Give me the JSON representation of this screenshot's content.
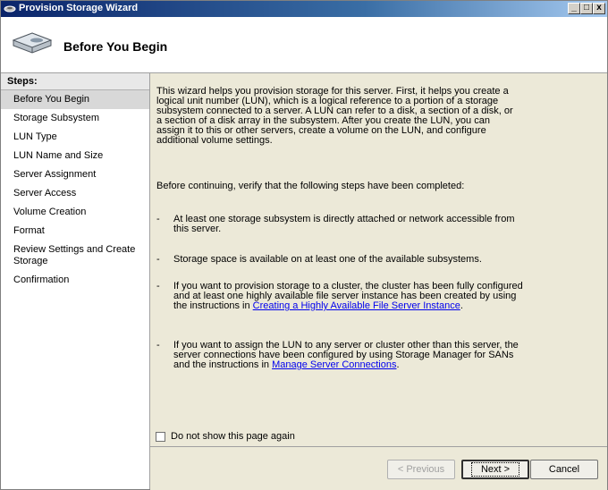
{
  "window": {
    "title": "Provision Storage Wizard"
  },
  "titlebar_buttons": {
    "minimize": "_",
    "maximize": "□",
    "close": "x"
  },
  "header": {
    "title": "Before You Begin"
  },
  "steps": {
    "label": "Steps:",
    "items": [
      {
        "line1": "Before You Begin",
        "line2": ""
      },
      {
        "line1": "Storage Subsystem",
        "line2": ""
      },
      {
        "line1": "LUN Type",
        "line2": ""
      },
      {
        "line1": "LUN Name and Size",
        "line2": ""
      },
      {
        "line1": "Server Assignment",
        "line2": ""
      },
      {
        "line1": "Server Access",
        "line2": ""
      },
      {
        "line1": "Volume Creation",
        "line2": ""
      },
      {
        "line1": "Format",
        "line2": ""
      },
      {
        "line1": "Review Settings and Create",
        "line2": "Storage"
      },
      {
        "line1": "Confirmation",
        "line2": ""
      }
    ]
  },
  "content": {
    "intro": "This wizard helps you provision storage for this server. First, it helps you create a logical unit number (LUN), which is a logical reference to a portion of a storage subsystem connected to a server. A LUN can refer to a disk, a section of a disk, or a section of a disk array in the subsystem. After you create the LUN, you can assign it to this or other servers, create a volume on the LUN, and configure additional volume settings.",
    "verify": "Before continuing, verify that the following steps have been completed:",
    "bullet_dash": "-",
    "bullet1": "At least one storage subsystem is directly attached or network accessible from this server.",
    "bullet2": "Storage space is available on at least one of the available subsystems.",
    "bullet3_text": "If you want to provision storage to a cluster, the cluster has been fully configured and at least one highly available file server instance has been created by using the instructions in",
    "bullet3_link": "Creating a Highly Available File Server Instance",
    "bullet3_end": ".",
    "bullet4_text": "If you want to assign the LUN to any server or cluster other than this server, the server connections have been configured by using Storage Manager for SANs and the instructions in",
    "bullet4_link": "Manage Server Connections",
    "bullet4_end": ".",
    "checkbox_label": "Do not show this page again"
  },
  "footer": {
    "previous": "< Previous",
    "next": "Next >",
    "cancel": "Cancel"
  }
}
